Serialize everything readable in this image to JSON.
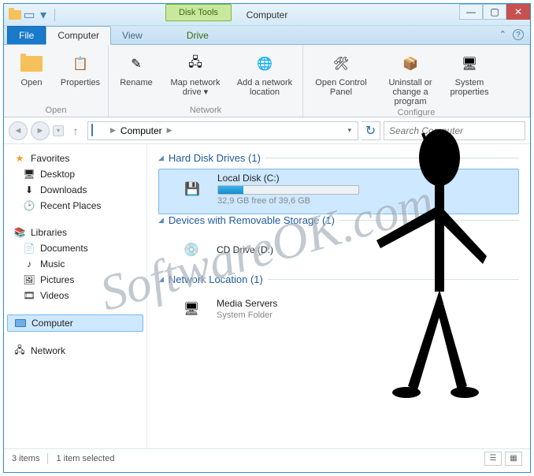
{
  "titlebar": {
    "contextual_label": "Disk Tools",
    "title": "Computer"
  },
  "tabs": {
    "file": "File",
    "computer": "Computer",
    "view": "View",
    "drive": "Drive"
  },
  "ribbon": {
    "open_group": "Open",
    "network_group": "Network",
    "configure_group": "Configure",
    "open": "Open",
    "properties": "Properties",
    "rename": "Rename",
    "map_drive": "Map network drive ▾",
    "add_location": "Add a network location",
    "control_panel": "Open Control Panel",
    "uninstall": "Uninstall or change a program",
    "system": "System properties"
  },
  "address": {
    "root": "Computer"
  },
  "search": {
    "placeholder": "Search Computer"
  },
  "tree": {
    "favorites": "Favorites",
    "desktop": "Desktop",
    "downloads": "Downloads",
    "recent": "Recent Places",
    "libraries": "Libraries",
    "documents": "Documents",
    "music": "Music",
    "pictures": "Pictures",
    "videos": "Videos",
    "computer": "Computer",
    "network": "Network"
  },
  "groups": {
    "hdd": "Hard Disk Drives (1)",
    "removable": "Devices with Removable Storage (1)",
    "netloc": "Network Location (1)"
  },
  "drives": {
    "local_name": "Local Disk (C:)",
    "local_free": "32,9 GB free of 39,6 GB",
    "cd_name": "CD Drive (D:)",
    "media_name": "Media Servers",
    "media_sub": "System Folder"
  },
  "status": {
    "items": "3 items",
    "selected": "1 item selected"
  },
  "watermark": "SoftwareOK.com"
}
